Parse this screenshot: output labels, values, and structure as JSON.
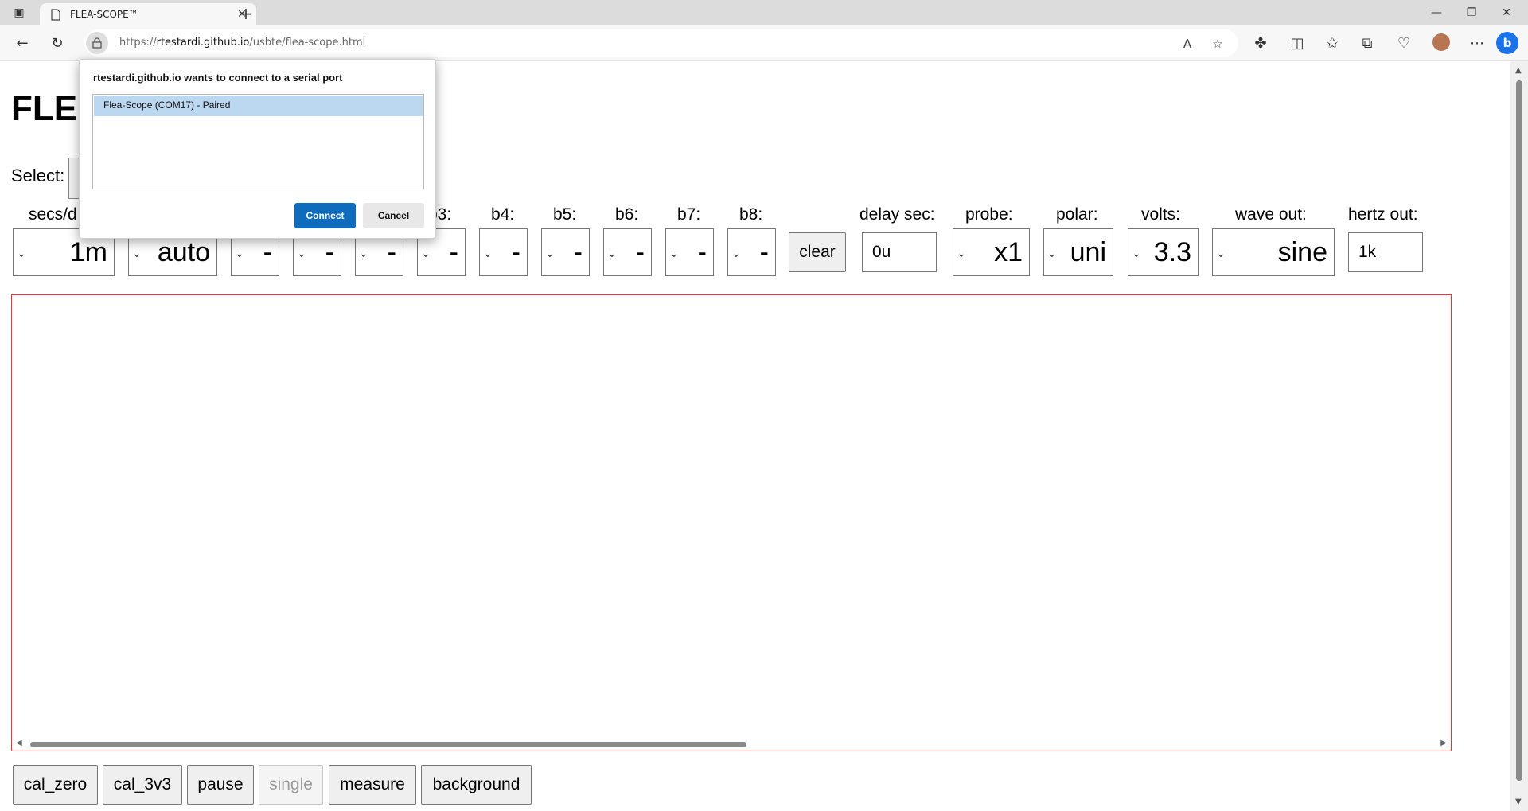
{
  "browser": {
    "tab_title": "FLEA-SCOPE™",
    "url_prefix": "https://",
    "url_host": "rtestardi.github.io",
    "url_path": "/usbte/flea-scope.html"
  },
  "page": {
    "heading": "FLE",
    "select_label": "Select:",
    "labels": {
      "secs_div": "secs/d",
      "b3": "b3:",
      "b4": "b4:",
      "b5": "b5:",
      "b6": "b6:",
      "b7": "b7:",
      "b8": "b8:",
      "delay_sec": "delay sec:",
      "probe": "probe:",
      "polar": "polar:",
      "volts": "volts:",
      "wave_out": "wave out:",
      "hertz_out": "hertz out:"
    },
    "values": {
      "secs_div": "1m",
      "trigger": "auto",
      "b1": "-",
      "b2": "-",
      "b3": "-",
      "b4": "-",
      "b5": "-",
      "b6": "-",
      "b7": "-",
      "b8": "-",
      "b9": "-",
      "delay_sec": "0u",
      "probe": "x1",
      "polar": "uni",
      "volts": "3.3",
      "wave_out": "sine",
      "hertz_out": "1k"
    },
    "clear_label": "clear",
    "bottom_buttons": [
      "cal_zero",
      "cal_3v3",
      "pause",
      "single",
      "measure",
      "background"
    ]
  },
  "dialog": {
    "title": "rtestardi.github.io wants to connect to a serial port",
    "items": [
      "Flea-Scope (COM17) - Paired"
    ],
    "connect_label": "Connect",
    "cancel_label": "Cancel"
  },
  "colors": {
    "canvas_border": "#ee3333",
    "selected_item": "#bcd8f1",
    "primary_button": "#0f6cbd"
  }
}
